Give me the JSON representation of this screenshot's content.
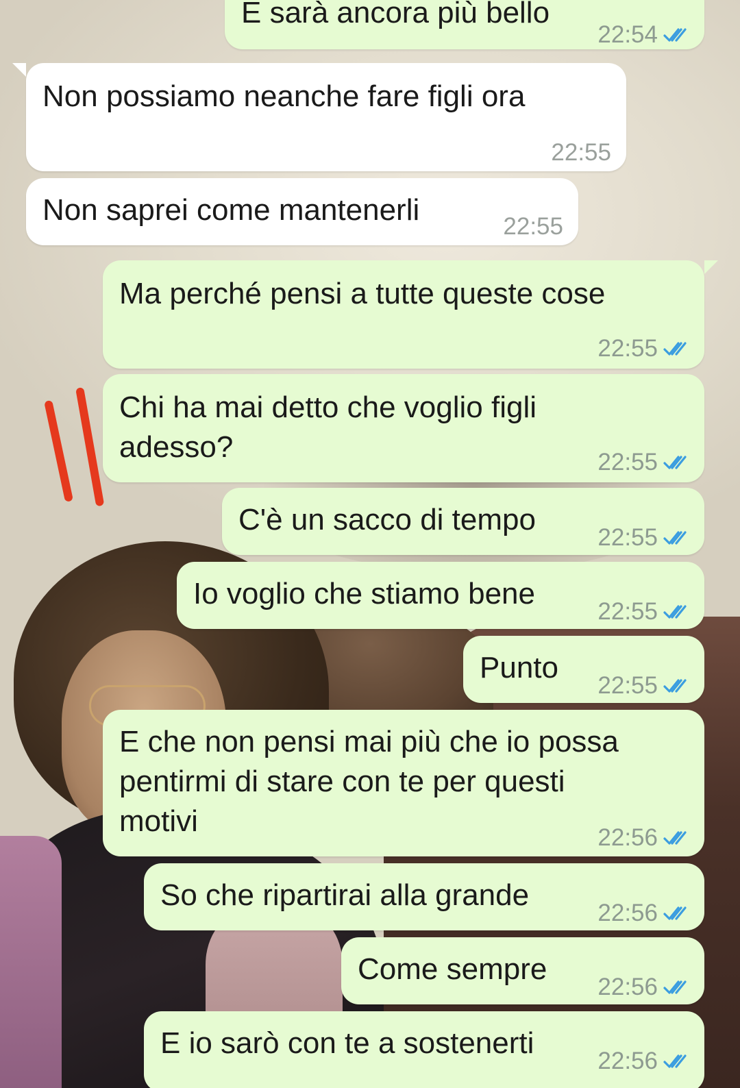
{
  "colors": {
    "outgoing_bubble": "#e6fbd2",
    "incoming_bubble": "#ffffff",
    "read_ticks": "#3b9de0",
    "annotation_marker": "#e5391d"
  },
  "icons": {
    "read_status": "double-check-read-icon"
  },
  "messages": [
    {
      "direction": "out",
      "text": "E sarà ancora più bello",
      "time": "22:54",
      "read": true
    },
    {
      "direction": "in",
      "text": "Non possiamo neanche fare figli ora",
      "time": "22:55"
    },
    {
      "direction": "in",
      "text": "Non saprei come mantenerli",
      "time": "22:55"
    },
    {
      "direction": "out",
      "text": "Ma perché pensi a tutte queste cose",
      "time": "22:55",
      "read": true
    },
    {
      "direction": "out",
      "text": "Chi ha mai detto che voglio figli\nadesso?",
      "time": "22:55",
      "read": true
    },
    {
      "direction": "out",
      "text": "C'è un sacco di tempo",
      "time": "22:55",
      "read": true
    },
    {
      "direction": "out",
      "text": "Io voglio che stiamo bene",
      "time": "22:55",
      "read": true
    },
    {
      "direction": "out",
      "text": "Punto",
      "time": "22:55",
      "read": true
    },
    {
      "direction": "out",
      "text": "E che non pensi mai più che io possa\npentirmi di stare con te per questi\nmotivi",
      "time": "22:56",
      "read": true
    },
    {
      "direction": "out",
      "text": "So che ripartirai alla grande",
      "time": "22:56",
      "read": true
    },
    {
      "direction": "out",
      "text": "Come sempre",
      "time": "22:56",
      "read": true
    },
    {
      "direction": "out",
      "text": "E io sarò con te a sostenerti",
      "time": "22:56",
      "read": true
    }
  ]
}
